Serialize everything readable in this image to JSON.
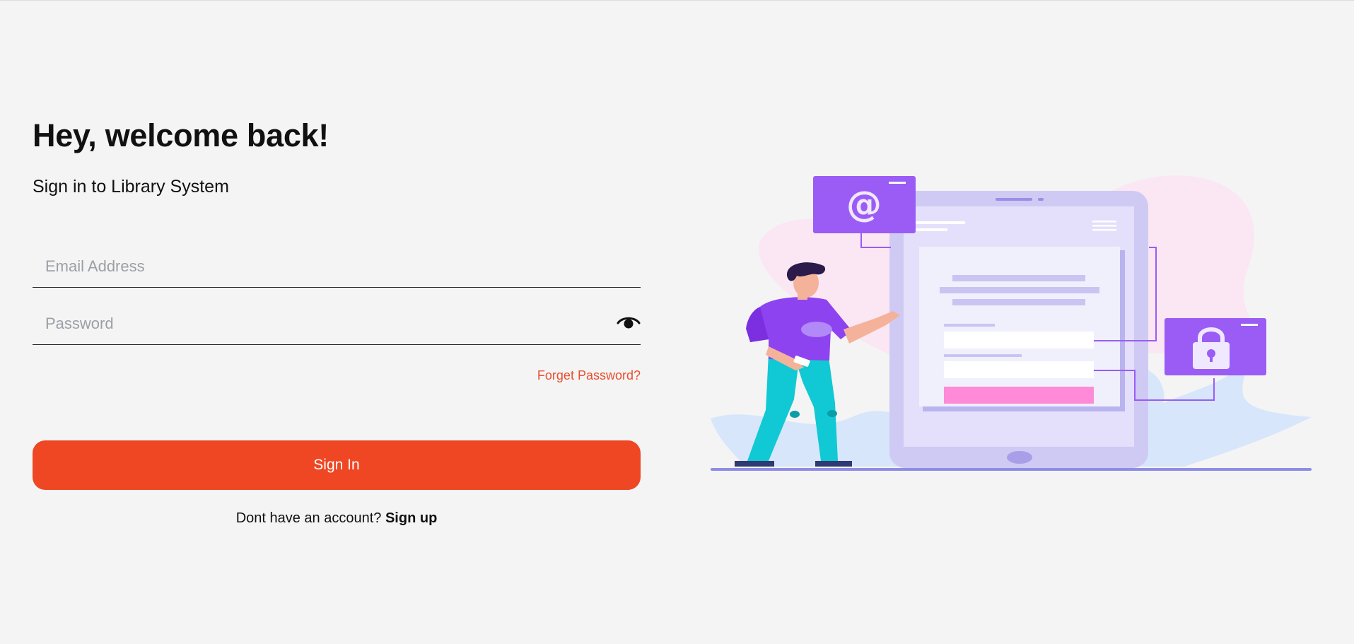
{
  "header": {
    "title": "Hey, welcome back!",
    "subtitle": "Sign in to Library System"
  },
  "form": {
    "email_placeholder": "Email Address",
    "email_value": "",
    "password_placeholder": "Password",
    "password_value": "",
    "password_toggle_icon": "eye-icon",
    "forgot_label": "Forget Password?",
    "submit_label": "Sign In"
  },
  "footer": {
    "prompt": "Dont have an account? ",
    "signup_label": "Sign up"
  },
  "illustration": {
    "icons": [
      "at-sign-icon",
      "lock-icon",
      "tablet-icon",
      "person-figure"
    ]
  },
  "colors": {
    "accent": "#ef4723",
    "link": "#e84f2e",
    "illustration_purple": "#9b5cf6",
    "illustration_pink": "#ff8ad8",
    "illustration_teal": "#10c9d4"
  }
}
